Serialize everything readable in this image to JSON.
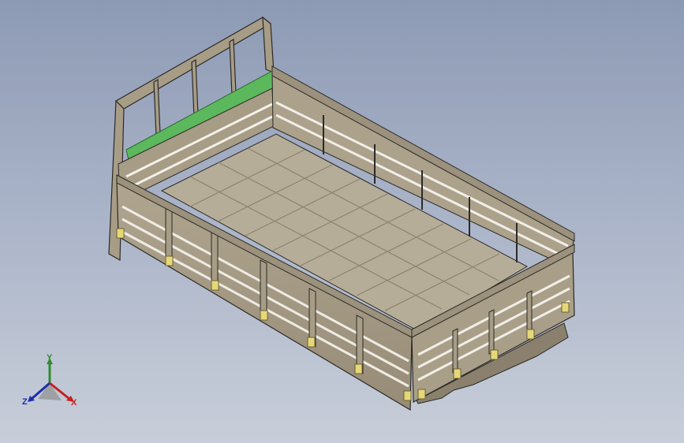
{
  "viewport": {
    "background_top": "#8d9ab4",
    "background_bottom": "#c8ced9"
  },
  "model": {
    "part_color": "#a79c86",
    "edge_color": "#2b2a26",
    "floor_color": "#b6ad99",
    "highlight_color": "#5cb85c",
    "hinge_color": "#e6d878"
  },
  "triad": {
    "x_label": "X",
    "y_label": "Y",
    "z_label": "Z",
    "x_color": "#c62020",
    "y_color": "#2e8b2e",
    "z_color": "#1a2fa8"
  }
}
